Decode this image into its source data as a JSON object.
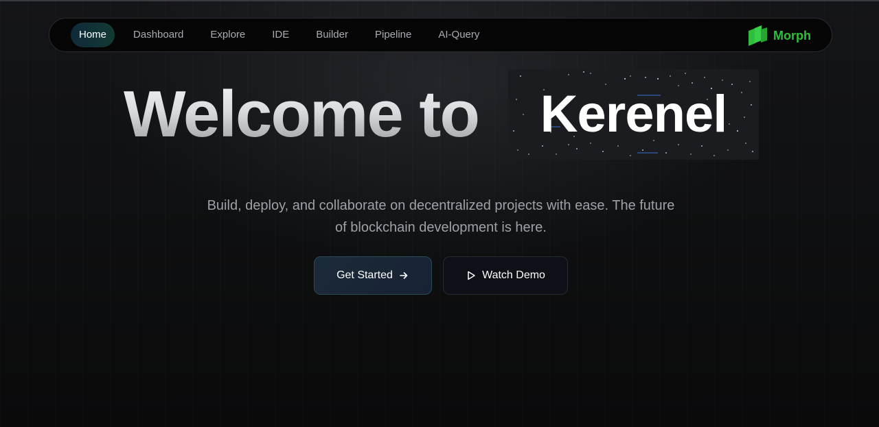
{
  "nav": {
    "items": [
      {
        "label": "Home",
        "active": true
      },
      {
        "label": "Dashboard",
        "active": false
      },
      {
        "label": "Explore",
        "active": false
      },
      {
        "label": "IDE",
        "active": false
      },
      {
        "label": "Builder",
        "active": false
      },
      {
        "label": "Pipeline",
        "active": false
      },
      {
        "label": "AI-Query",
        "active": false
      }
    ]
  },
  "brand": {
    "name": "Morph",
    "logo_icon": "morph-logo-icon",
    "color": "#2fbf3c"
  },
  "hero": {
    "title_prefix": "Welcome to",
    "title_highlight": "Kerenel",
    "subtitle": "Build, deploy, and collaborate on decentralized projects with ease. The future of blockchain development is here."
  },
  "buttons": {
    "primary": {
      "label": "Get Started",
      "icon": "arrow-right-icon"
    },
    "secondary": {
      "label": "Watch Demo",
      "icon": "play-icon"
    }
  },
  "colors": {
    "background": "#0b0b0c",
    "nav_active": "#123a34",
    "brand": "#2fbf3c"
  }
}
